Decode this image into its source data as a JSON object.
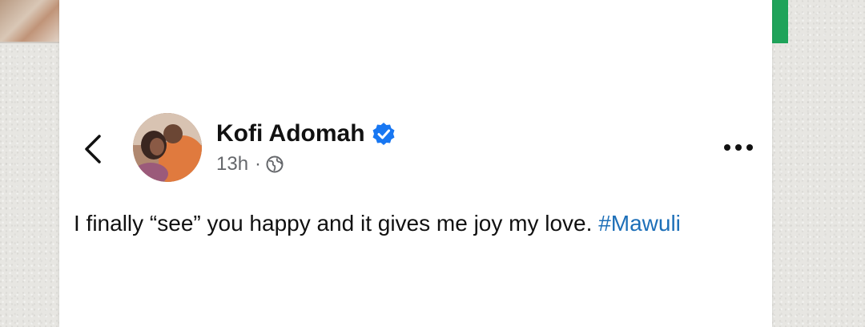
{
  "post": {
    "author_name": "Kofi Adomah",
    "timestamp": "13h",
    "separator": "·",
    "audience_icon": "globe-icon",
    "verified_icon": "verified-badge-icon",
    "text": "I finally “see” you happy and it gives me joy my love.",
    "hashtag": "#Mawuli"
  },
  "header": {
    "back_icon": "chevron-left-icon",
    "more_icon": "more-options-icon"
  },
  "colors": {
    "verified": "#1877f2",
    "hashtag": "#1d6fb8",
    "meta_text": "#65676b",
    "accent_strip": "#1fa35a"
  }
}
